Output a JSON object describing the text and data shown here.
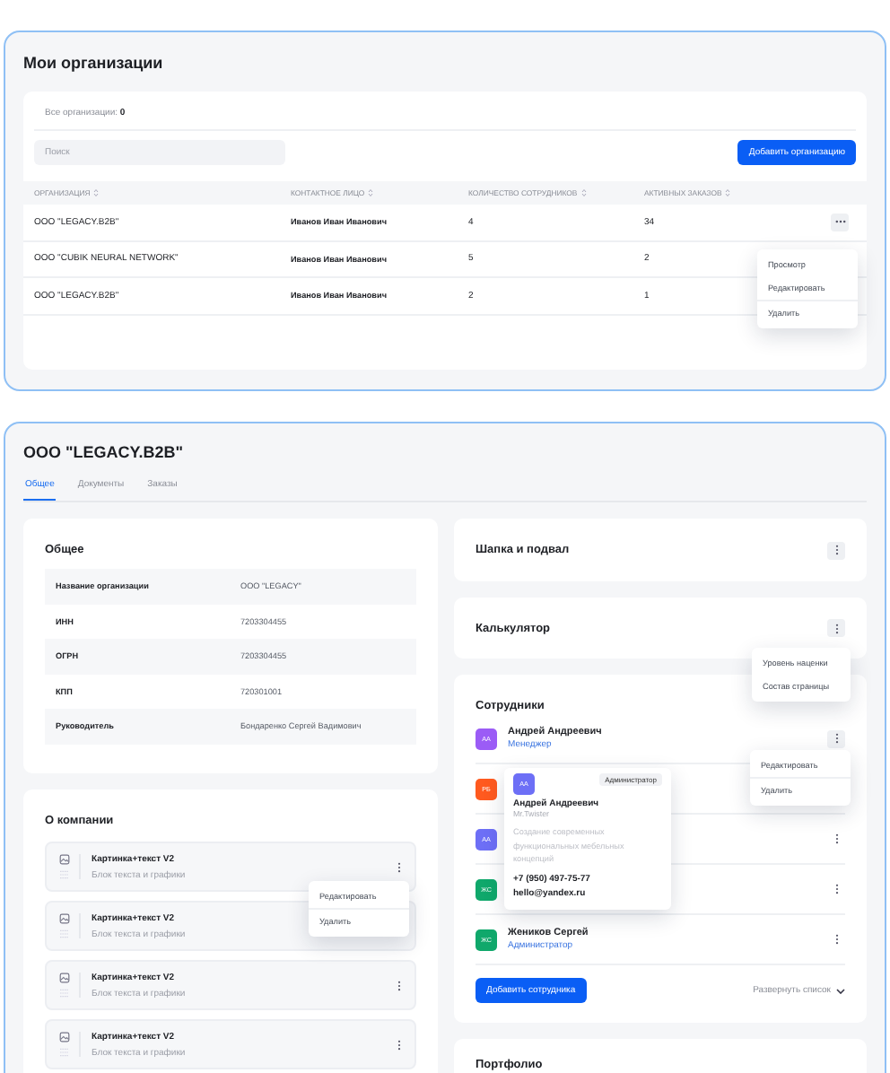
{
  "orgs_panel": {
    "title": "Мои организации",
    "count_label": "Все организации:",
    "count": "0",
    "search": {
      "placeholder": "Поиск"
    },
    "add_button": "Добавить организацию",
    "columns": [
      "ОРГАНИЗАЦИЯ",
      "КОНТАКТНОЕ ЛИЦО",
      "КОЛИЧЕСТВО СОТРУДНИКОВ",
      "АКТИВНЫХ ЗАКАЗОВ"
    ],
    "rows": [
      {
        "cells": [
          "ООО \"LEGACY.B2B\"",
          "Иванов Иван Иванович",
          "4",
          "34"
        ],
        "menu_button": true
      },
      {
        "cells": [
          "ООО \"CUBIK NEURAL NETWORK\"",
          "Иванов Иван Иванович",
          "5",
          "2"
        ],
        "menu_button": false
      },
      {
        "cells": [
          "ООО \"LEGACY.B2B\"",
          "Иванов Иван Иванович",
          "2",
          "1"
        ],
        "menu_button": false
      }
    ],
    "row_menu": [
      {
        "label": "Просмотр",
        "separated": false
      },
      {
        "label": "Редактировать",
        "separated": false
      },
      {
        "label": "Удалить",
        "separated": true
      }
    ]
  },
  "org_detail": {
    "title": "ООО \"LEGACY.B2B\"",
    "tabs": [
      {
        "label": "Общее",
        "selected": true
      },
      {
        "label": "Документы",
        "selected": false
      },
      {
        "label": "Заказы",
        "selected": false
      }
    ],
    "general": {
      "title": "Общее",
      "fields": [
        {
          "label": "Название организации",
          "value": "ООО \"LEGACY\""
        },
        {
          "label": "ИНН",
          "value": "7203304455"
        },
        {
          "label": "ОГРН",
          "value": "7203304455"
        },
        {
          "label": "КПП",
          "value": "720301001"
        },
        {
          "label": "Руководитель",
          "value": "Бондаренко Сергей Вадимович"
        }
      ]
    },
    "about": {
      "title": "О компании",
      "blocks": [
        {
          "title": "Картинка+текст V2",
          "subtitle": "Блок текста и графики",
          "menu_button": true
        },
        {
          "title": "Картинка+текст V2",
          "subtitle": "Блок текста и графики",
          "menu_button": false
        },
        {
          "title": "Картинка+текст V2",
          "subtitle": "Блок текста и графики",
          "menu_button": true
        },
        {
          "title": "Картинка+текст V2",
          "subtitle": "Блок текста и графики",
          "menu_button": true
        }
      ],
      "block_menu": [
        {
          "label": "Редактировать",
          "separated": false
        },
        {
          "label": "Удалить",
          "separated": true
        }
      ]
    },
    "header_footer": {
      "title": "Шапка и подвал"
    },
    "calculator": {
      "title": "Калькулятор",
      "menu": [
        {
          "label": "Уровень наценки",
          "separated": false
        },
        {
          "label": "Состав страницы",
          "separated": false
        }
      ]
    },
    "employees": {
      "title": "Сотрудники",
      "members": [
        {
          "initials": "АА",
          "color": "#9b5cf6",
          "name": "Андрей Андреевич",
          "role": "Менеджер",
          "menu_button": true
        },
        {
          "initials": "РБ",
          "color": "#ff5a1f",
          "menu_button": false
        },
        {
          "initials": "АА",
          "color": "#6d6ff6",
          "menu_button": true
        },
        {
          "initials": "ЖС",
          "color": "#10a86b",
          "menu_button": true
        },
        {
          "initials": "ЖС",
          "color": "#10a86b",
          "name": "Жеников Сергей",
          "role": "Администратор",
          "menu_button": true
        }
      ],
      "member_menu": [
        {
          "label": "Редактировать",
          "separated": false
        },
        {
          "label": "Удалить",
          "separated": true
        }
      ],
      "popover": {
        "initials": "АА",
        "color": "#6d6ff6",
        "badge": "Администратор",
        "name": "Андрей Андреевич",
        "nickname": "Mr.Twister",
        "description": "Создание современных функциональных мебельных концепций",
        "phone": "+7 (950) 497-75-77",
        "email": "hello@yandex.ru"
      },
      "add_button": "Добавить сотрудника",
      "expand": "Развернуть список"
    },
    "portfolio": {
      "title": "Портфолио"
    }
  }
}
